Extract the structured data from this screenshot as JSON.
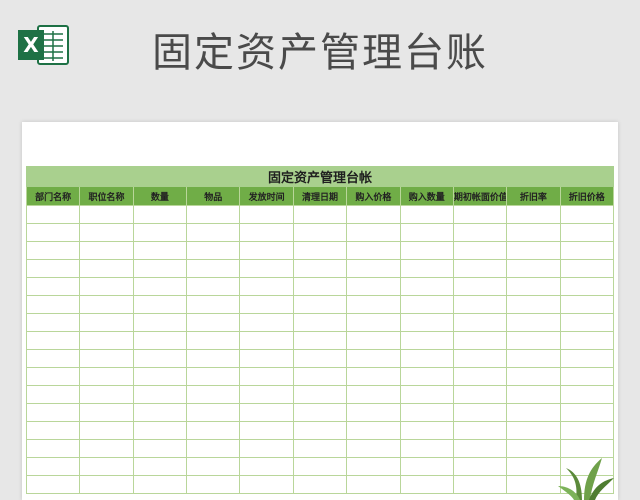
{
  "page": {
    "heading": "固定资产管理台账"
  },
  "app_icon": {
    "name": "excel-icon",
    "letter": "X",
    "color": "#1e7145"
  },
  "sheet": {
    "title": "固定资产管理台帐",
    "columns": [
      "部门名称",
      "职位名称",
      "数量",
      "物品",
      "发放时间",
      "清理日期",
      "购入价格",
      "购入数量",
      "期初帐面价值",
      "折旧率",
      "折旧价格"
    ],
    "empty_rows": 16
  },
  "colors": {
    "title_fill": "#a9d08e",
    "header_fill": "#70ad47",
    "grid_line": "#b9d69a",
    "background": "#e7e7e7"
  }
}
